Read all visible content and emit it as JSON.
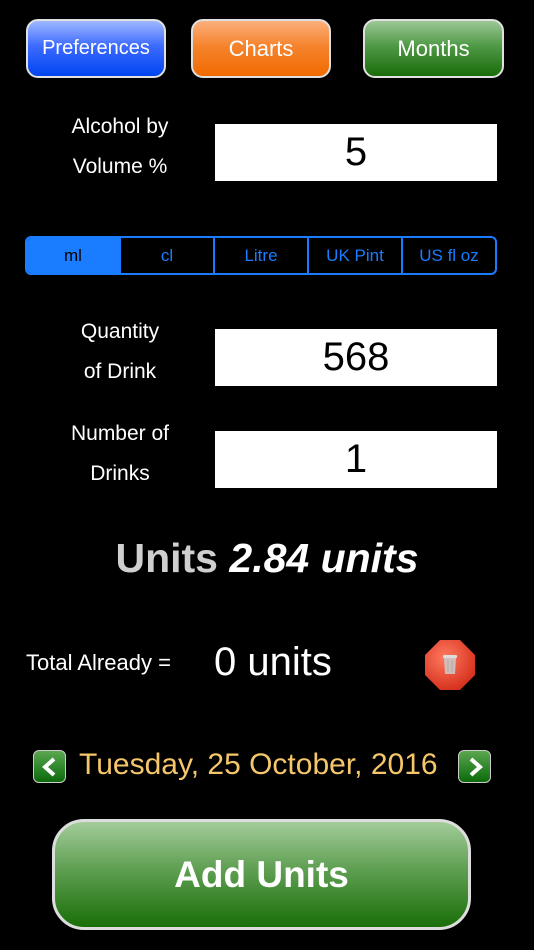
{
  "top_buttons": {
    "preferences": "Preferences",
    "charts": "Charts",
    "months": "Months"
  },
  "abv": {
    "label_line1": "Alcohol by",
    "label_line2": "Volume %",
    "value": "5"
  },
  "volume_units": {
    "options": [
      "ml",
      "cl",
      "Litre",
      "UK Pint",
      "US fl oz"
    ],
    "selected": "ml"
  },
  "quantity": {
    "label_line1": "Quantity",
    "label_line2": "of Drink",
    "value": "568"
  },
  "drinks": {
    "label_line1": "Number of",
    "label_line2": "Drinks",
    "value": "1"
  },
  "result": {
    "label": "Units",
    "value": "2.84 units"
  },
  "total": {
    "label": "Total Already =",
    "value": "0 units"
  },
  "date": {
    "text": "Tuesday, 25 October, 2016"
  },
  "add_button": {
    "label": "Add Units"
  },
  "colors": {
    "accent": "#1a7cff",
    "date": "#f5c76a",
    "trash": "#e8402a"
  }
}
